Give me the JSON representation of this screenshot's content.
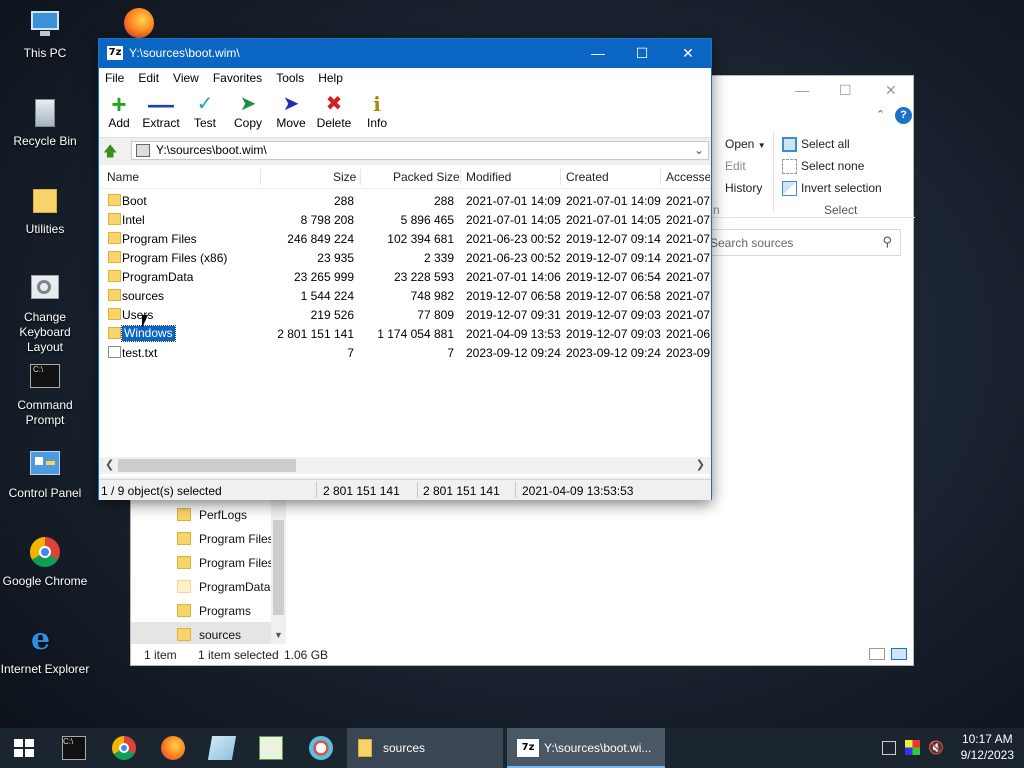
{
  "desktop": {
    "icons": [
      {
        "label": "This PC",
        "icon": "monitor-icon"
      },
      {
        "label": "Recycle Bin",
        "icon": "recycle-bin-icon"
      },
      {
        "label": "Utilities",
        "icon": "folder-icon"
      },
      {
        "label": "Change Keyboard Layout",
        "icon": "keyboard-settings-icon"
      },
      {
        "label": "Command Prompt",
        "icon": "terminal-icon"
      },
      {
        "label": "Control Panel",
        "icon": "control-panel-icon"
      },
      {
        "label": "Google Chrome",
        "icon": "chrome-icon"
      },
      {
        "label": "Internet Explorer",
        "icon": "ie-icon"
      }
    ]
  },
  "explorer": {
    "ribbon": {
      "open": "Open",
      "edit": "Edit",
      "history": "History",
      "select_all": "Select all",
      "select_none": "Select none",
      "invert_selection": "Invert selection",
      "group_select": "Select",
      "group_open_suffix": "n"
    },
    "search_placeholder": "Search sources",
    "tree": [
      {
        "label": "PerfLogs"
      },
      {
        "label": "Program Files"
      },
      {
        "label": "Program Files"
      },
      {
        "label": "ProgramData"
      },
      {
        "label": "Programs"
      },
      {
        "label": "sources"
      }
    ],
    "status": {
      "count": "1 item",
      "selected": "1 item selected",
      "size": "1.06 GB"
    }
  },
  "zip": {
    "title": "Y:\\sources\\boot.wim\\",
    "menu": [
      "File",
      "Edit",
      "View",
      "Favorites",
      "Tools",
      "Help"
    ],
    "toolbar": [
      "Add",
      "Extract",
      "Test",
      "Copy",
      "Move",
      "Delete",
      "Info"
    ],
    "address": "Y:\\sources\\boot.wim\\",
    "columns": [
      "Name",
      "Size",
      "Packed Size",
      "Modified",
      "Created",
      "Accesse"
    ],
    "rows": [
      {
        "name": "Boot",
        "size": "288",
        "packed": "288",
        "modified": "2021-07-01 14:09",
        "created": "2021-07-01 14:09",
        "accessed": "2021-07-",
        "type": "folder"
      },
      {
        "name": "Intel",
        "size": "8 798 208",
        "packed": "5 896 465",
        "modified": "2021-07-01 14:05",
        "created": "2021-07-01 14:05",
        "accessed": "2021-07-",
        "type": "folder"
      },
      {
        "name": "Program Files",
        "size": "246 849 224",
        "packed": "102 394 681",
        "modified": "2021-06-23 00:52",
        "created": "2019-12-07 09:14",
        "accessed": "2021-07-",
        "type": "folder"
      },
      {
        "name": "Program Files (x86)",
        "size": "23 935",
        "packed": "2 339",
        "modified": "2021-06-23 00:52",
        "created": "2019-12-07 09:14",
        "accessed": "2021-07-",
        "type": "folder"
      },
      {
        "name": "ProgramData",
        "size": "23 265 999",
        "packed": "23 228 593",
        "modified": "2021-07-01 14:06",
        "created": "2019-12-07 06:54",
        "accessed": "2021-07-",
        "type": "folder"
      },
      {
        "name": "sources",
        "size": "1 544 224",
        "packed": "748 982",
        "modified": "2019-12-07 06:58",
        "created": "2019-12-07 06:58",
        "accessed": "2021-07-",
        "type": "folder"
      },
      {
        "name": "Users",
        "size": "219 526",
        "packed": "77 809",
        "modified": "2019-12-07 09:31",
        "created": "2019-12-07 09:03",
        "accessed": "2021-07-",
        "type": "folder"
      },
      {
        "name": "Windows",
        "size": "2 801 151 141",
        "packed": "1 174 054 881",
        "modified": "2021-04-09 13:53",
        "created": "2019-12-07 09:03",
        "accessed": "2021-06-",
        "type": "folder",
        "selected": true
      },
      {
        "name": "test.txt",
        "size": "7",
        "packed": "7",
        "modified": "2023-09-12 09:24",
        "created": "2023-09-12 09:24",
        "accessed": "2023-09-",
        "type": "file"
      }
    ],
    "status": {
      "selection": "1 / 9 object(s) selected",
      "size": "2 801 151 141",
      "packed": "2 801 151 141",
      "modified": "2021-04-09 13:53:53"
    }
  },
  "taskbar": {
    "tasks": [
      {
        "label": "sources"
      },
      {
        "label": "Y:\\sources\\boot.wi..."
      }
    ],
    "time": "10:17 AM",
    "date": "9/12/2023"
  }
}
